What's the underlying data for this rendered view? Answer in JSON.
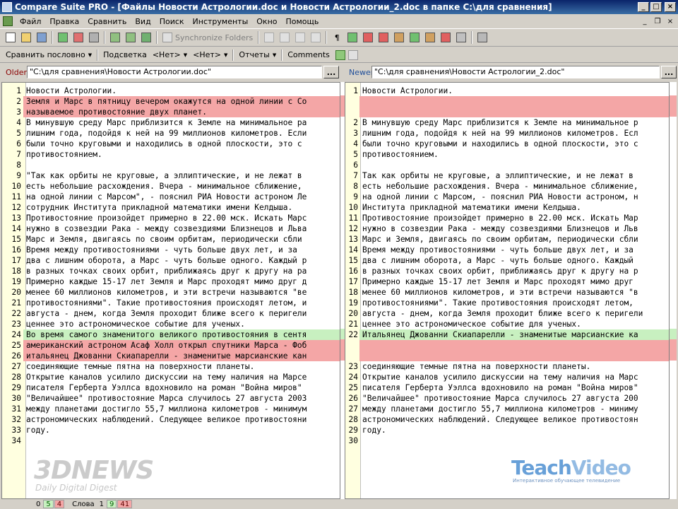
{
  "window": {
    "title": "Compare Suite PRO - [Файлы Новости Астрологии.doc и Новости Астрологии_2.doc в папке C:\\для сравнения]",
    "minimize": "_",
    "maximize": "□",
    "close": "×"
  },
  "menu": {
    "items": [
      "Файл",
      "Правка",
      "Сравнить",
      "Вид",
      "Поиск",
      "Инструменты",
      "Окно",
      "Помощь"
    ],
    "mdi_minimize": "_",
    "mdi_restore": "❐",
    "mdi_close": "×"
  },
  "toolbar": {
    "sync_folders_label": "Synchronize Folders"
  },
  "toolbar2": {
    "compare_mode": "Сравнить пословно",
    "highlight_label": "Подсветка",
    "highlight_value1": "<Нет>",
    "highlight_value2": "<Нет>",
    "reports_label": "Отчеты",
    "comments_label": "Comments"
  },
  "left": {
    "label": "Older",
    "path": "\"C:\\для сравнения\\Новости Астрологии.doc\"",
    "browse": "...",
    "lines": [
      {
        "n": "1",
        "t": "Новости Астрологии.",
        "s": ""
      },
      {
        "n": "2",
        "t": "Земля и Марс в пятницу вечером окажутся на одной линии с Со",
        "s": "del"
      },
      {
        "n": "3",
        "t": "называемое противостояние двух планет.",
        "s": "del"
      },
      {
        "n": "4",
        "t": "В минувшую среду Марс приблизится к Земле на минимальное ра",
        "s": ""
      },
      {
        "n": "5",
        "t": "лишним года, подойдя к ней на 99 миллионов километров. Если",
        "s": ""
      },
      {
        "n": "6",
        "t": "были точно круговыми и находились в одной плоскости, это с",
        "s": ""
      },
      {
        "n": "7",
        "t": "противостоянием.",
        "s": ""
      },
      {
        "n": "8",
        "t": "",
        "s": ""
      },
      {
        "n": "9",
        "t": "\"Так как орбиты не круговые, а эллиптические, и не лежат в",
        "s": ""
      },
      {
        "n": "10",
        "t": "есть небольшие расхождения. Вчера - минимальное сближение,",
        "s": ""
      },
      {
        "n": "11",
        "t": "на одной линии с Марсом\", - пояснил РИА Новости астроном Ле",
        "s": ""
      },
      {
        "n": "12",
        "t": "сотрудник Института прикладной математики имени Келдыша.",
        "s": ""
      },
      {
        "n": "13",
        "t": "Противостояние произойдет примерно в 22.00 мск. Искать Марс",
        "s": ""
      },
      {
        "n": "14",
        "t": "нужно в созвездии Рака - между созвездиями Близнецов и Льва",
        "s": ""
      },
      {
        "n": "15",
        "t": "Марс и Земля, двигаясь по своим орбитам, периодически сбли",
        "s": ""
      },
      {
        "n": "16",
        "t": "Время между противостояниями - чуть больше двух лет, и за",
        "s": ""
      },
      {
        "n": "17",
        "t": "два с лишним оборота, а Марс - чуть больше одного. Каждый р",
        "s": ""
      },
      {
        "n": "18",
        "t": "в разных точках своих орбит, приближаясь друг к другу на ра",
        "s": ""
      },
      {
        "n": "19",
        "t": "Примерно каждые 15-17 лет Земля и Марс проходят мимо друг д",
        "s": ""
      },
      {
        "n": "20",
        "t": "менее 60 миллионов километров, и эти встречи называются \"ве",
        "s": ""
      },
      {
        "n": "21",
        "t": "противостояниями\". Такие противостояния происходят летом, и",
        "s": ""
      },
      {
        "n": "22",
        "t": "августа - днем, когда Земля проходит ближе всего к перигели",
        "s": ""
      },
      {
        "n": "23",
        "t": "ценнее это астрономическое событие для ученых.",
        "s": ""
      },
      {
        "n": "24",
        "t": "Во время самого знаменитого великого противостояния в сентя",
        "s": "add"
      },
      {
        "n": "25",
        "t": "американский астроном Асаф Холл открыл спутники Марса - Фоб",
        "s": "del"
      },
      {
        "n": "26",
        "t": "итальянец Джованни Скиапарелли - знаменитые марсианские кан",
        "s": "del"
      },
      {
        "n": "27",
        "t": "соединяющие темные пятна на поверхности планеты.",
        "s": ""
      },
      {
        "n": "28",
        "t": "Открытие каналов усилило дискуссии на тему наличия на Марсе",
        "s": ""
      },
      {
        "n": "29",
        "t": "писателя Герберта Уэллса вдохновило на роман \"Война миров\"",
        "s": ""
      },
      {
        "n": "30",
        "t": "\"Величайшее\" противостояние Марса случилось 27 августа 2003",
        "s": ""
      },
      {
        "n": "31",
        "t": "между планетами достигло 55,7 миллиона километров - минимум",
        "s": ""
      },
      {
        "n": "32",
        "t": "астрономических наблюдений. Следующее великое противостояни",
        "s": ""
      },
      {
        "n": "33",
        "t": "году.",
        "s": ""
      },
      {
        "n": "34",
        "t": "",
        "s": ""
      }
    ]
  },
  "right": {
    "label": "Newer",
    "path": "\"C:\\для сравнения\\Новости Астрологии_2.doc\"",
    "browse": "...",
    "lines": [
      {
        "n": "1",
        "t": "Новости Астрологии.",
        "s": ""
      },
      {
        "n": "",
        "t": "",
        "s": "gap"
      },
      {
        "n": "",
        "t": "",
        "s": "gap"
      },
      {
        "n": "2",
        "t": "В минувшую среду Марс приблизится к Земле на минимальное р",
        "s": ""
      },
      {
        "n": "3",
        "t": "лишним года, подойдя к ней на 99 миллионов километров. Есл",
        "s": ""
      },
      {
        "n": "4",
        "t": "были точно круговыми и находились в одной плоскости, это с",
        "s": ""
      },
      {
        "n": "5",
        "t": "противостоянием.",
        "s": ""
      },
      {
        "n": "6",
        "t": "",
        "s": ""
      },
      {
        "n": "7",
        "t": "Так как орбиты не круговые, а эллиптические, и не лежат в",
        "s": ""
      },
      {
        "n": "8",
        "t": "есть небольшие расхождения. Вчера - минимальное сближение,",
        "s": ""
      },
      {
        "n": "9",
        "t": "на одной линии с Марсом, - пояснил РИА Новости астроном, н",
        "s": ""
      },
      {
        "n": "10",
        "t": "Института прикладной математики имени Келдыша.",
        "s": ""
      },
      {
        "n": "11",
        "t": "Противостояние произойдет примерно в 22.00 мск. Искать Мар",
        "s": ""
      },
      {
        "n": "12",
        "t": "нужно в созвездии Рака - между созвездиями Близнецов и Льв",
        "s": ""
      },
      {
        "n": "13",
        "t": "Марс и Земля, двигаясь по своим орбитам, периодически сбли",
        "s": ""
      },
      {
        "n": "14",
        "t": "Время между противостояниями - чуть больше двух лет, и за",
        "s": ""
      },
      {
        "n": "15",
        "t": "два с лишним оборота, а Марс - чуть больше одного. Каждый",
        "s": ""
      },
      {
        "n": "16",
        "t": "в разных точках своих орбит, приближаясь друг к другу на р",
        "s": ""
      },
      {
        "n": "17",
        "t": "Примерно каждые 15-17 лет Земля и Марс проходят мимо друг",
        "s": ""
      },
      {
        "n": "18",
        "t": "менее 60 миллионов километров, и эти встречи называются \"в",
        "s": ""
      },
      {
        "n": "19",
        "t": "противостояниями\". Такие противостояния происходят летом,",
        "s": ""
      },
      {
        "n": "20",
        "t": "августа - днем, когда Земля проходит ближе всего к перигели",
        "s": ""
      },
      {
        "n": "21",
        "t": "ценнее это астрономическое событие для ученых.",
        "s": ""
      },
      {
        "n": "22",
        "t": "Итальянец Джованни Скиапарелли - знаменитые марсианские ка",
        "s": "add"
      },
      {
        "n": "",
        "t": "",
        "s": "gap"
      },
      {
        "n": "",
        "t": "",
        "s": "gap"
      },
      {
        "n": "23",
        "t": "соединяющие темные пятна на поверхности планеты.",
        "s": ""
      },
      {
        "n": "24",
        "t": "Открытие каналов усилило дискуссии на тему наличия на Марс",
        "s": ""
      },
      {
        "n": "25",
        "t": "писателя Герберта Уэллса вдохновило на роман \"Война миров\"",
        "s": ""
      },
      {
        "n": "26",
        "t": "\"Величайшее\" противостояние Марса случилось 27 августа 200",
        "s": ""
      },
      {
        "n": "27",
        "t": "между планетами достигло 55,7 миллиона километров - миниму",
        "s": ""
      },
      {
        "n": "28",
        "t": "астрономических наблюдений. Следующее великое противостоян",
        "s": ""
      },
      {
        "n": "29",
        "t": "году.",
        "s": ""
      },
      {
        "n": "30",
        "t": "",
        "s": ""
      }
    ]
  },
  "status": {
    "left_counts": [
      "0",
      "5",
      "4"
    ],
    "words_label": "Слова",
    "right_counts": [
      "1",
      "9",
      "41"
    ]
  },
  "watermarks": {
    "left_brand": "3DNEWS",
    "left_tagline": "Daily Digital Digest",
    "right_brand_a": "Teach",
    "right_brand_b": "Video",
    "right_tagline": "Интерактивное обучающее телевидение"
  },
  "colors": {
    "deleted": "#f4a6a6",
    "added": "#c8f0c0",
    "gutter": "#ffffe0"
  }
}
